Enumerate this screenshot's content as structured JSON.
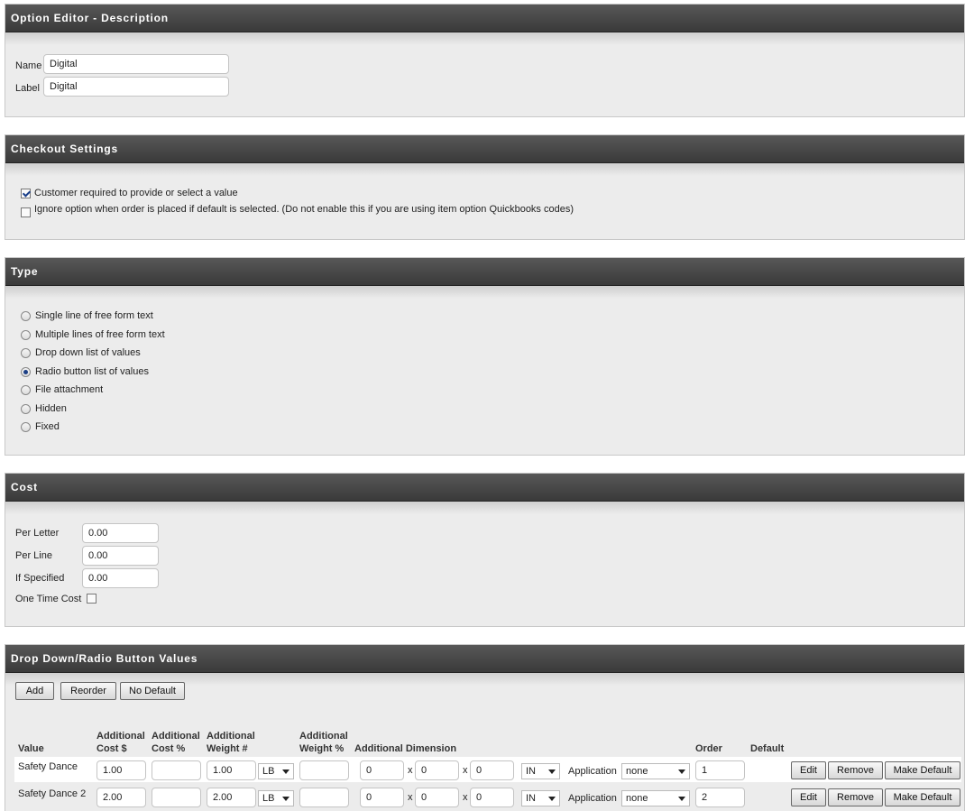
{
  "description": {
    "title": "Option Editor - Description",
    "name_label": "Name",
    "name_value": "Digital",
    "label_label": "Label",
    "label_value": "Digital"
  },
  "checkout": {
    "title": "Checkout Settings",
    "required_label": "Customer required to provide or select a value",
    "required_checked": true,
    "ignore_label": "Ignore option when order is placed if default is selected. (Do not enable this if you are using item option Quickbooks codes)",
    "ignore_checked": false
  },
  "type": {
    "title": "Type",
    "options": [
      {
        "label": "Single line of free form text",
        "selected": false
      },
      {
        "label": "Multiple lines of free form text",
        "selected": false
      },
      {
        "label": "Drop down list of values",
        "selected": false
      },
      {
        "label": "Radio button list of values",
        "selected": true
      },
      {
        "label": "File attachment",
        "selected": false
      },
      {
        "label": "Hidden",
        "selected": false
      },
      {
        "label": "Fixed",
        "selected": false
      }
    ]
  },
  "cost": {
    "title": "Cost",
    "per_letter_label": "Per Letter",
    "per_letter_value": "0.00",
    "per_line_label": "Per Line",
    "per_line_value": "0.00",
    "if_specified_label": "If Specified",
    "if_specified_value": "0.00",
    "one_time_label": "One Time Cost",
    "one_time_checked": false
  },
  "values": {
    "title": "Drop Down/Radio Button Values",
    "add_label": "Add",
    "reorder_label": "Reorder",
    "no_default_label": "No Default",
    "headers": {
      "value": "Value",
      "add_cost_1": "Additional",
      "add_cost_2": "Cost $",
      "add_costp_1": "Additional",
      "add_costp_2": "Cost %",
      "add_weight_1": "Additional",
      "add_weight_2": "Weight #",
      "add_weightp_1": "Additional",
      "add_weightp_2": "Weight %",
      "add_dim": "Additional Dimension",
      "order": "Order",
      "default": "Default"
    },
    "x_sep": "x",
    "application_label": "Application",
    "edit_label": "Edit",
    "remove_label": "Remove",
    "make_default_label": "Make Default",
    "rows": [
      {
        "value": "Safety Dance",
        "cost": "1.00",
        "cost_pct": "",
        "weight": "1.00",
        "weight_unit": "LB",
        "weight_pct": "",
        "dim1": "0",
        "dim2": "0",
        "dim3": "0",
        "dim_unit": "IN",
        "application": "none",
        "order": "1"
      },
      {
        "value": "Safety Dance 2",
        "cost": "2.00",
        "cost_pct": "",
        "weight": "2.00",
        "weight_unit": "LB",
        "weight_pct": "",
        "dim1": "0",
        "dim2": "0",
        "dim3": "0",
        "dim_unit": "IN",
        "application": "none",
        "order": "2"
      }
    ]
  }
}
